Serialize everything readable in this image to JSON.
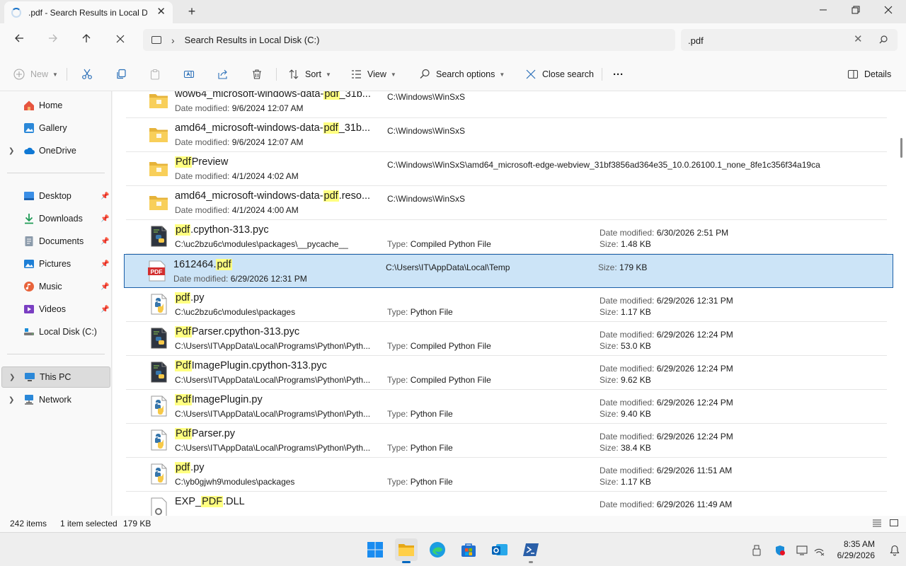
{
  "window": {
    "tab_title": ".pdf - Search Results in Local Disk (C:)",
    "new_tab": "+",
    "minimize": "—",
    "close": "✕"
  },
  "address": {
    "breadcrumb": "Search Results in Local Disk (C:)",
    "search_value": ".pdf",
    "search_placeholder": "Search"
  },
  "toolbar": {
    "new_label": "New",
    "sort_label": "Sort",
    "view_label": "View",
    "search_options_label": "Search options",
    "close_search_label": "Close search",
    "more_label": "···",
    "details_label": "Details"
  },
  "sidebar": {
    "items": [
      {
        "label": "Home"
      },
      {
        "label": "Gallery"
      },
      {
        "label": "OneDrive"
      },
      {
        "label": "Desktop"
      },
      {
        "label": "Downloads"
      },
      {
        "label": "Documents"
      },
      {
        "label": "Pictures"
      },
      {
        "label": "Music"
      },
      {
        "label": "Videos"
      },
      {
        "label": "Local Disk (C:)"
      },
      {
        "label": "This PC"
      },
      {
        "label": "Network"
      }
    ]
  },
  "results": {
    "date_key": "Date modified:",
    "type_key": "Type:",
    "size_key": "Size:",
    "rows": [
      {
        "pre": "wow64_microsoft-windows-data-",
        "hl": "pdf",
        "post": "_31b...",
        "sub": "9/6/2024 12:07 AM",
        "location": "C:\\Windows\\WinSxS",
        "icon": "folder-icon"
      },
      {
        "pre": "amd64_microsoft-windows-data-",
        "hl": "pdf",
        "post": "_31b...",
        "sub": "9/6/2024 12:07 AM",
        "location": "C:\\Windows\\WinSxS",
        "icon": "folder-icon"
      },
      {
        "pre": "",
        "hl": "Pdf",
        "post": "Preview",
        "sub": "4/1/2024 4:02 AM",
        "location": "C:\\Windows\\WinSxS\\amd64_microsoft-edge-webview_31bf3856ad364e35_10.0.26100.1_none_8fe1c356f34a19ca",
        "icon": "folder-icon"
      },
      {
        "pre": "amd64_microsoft-windows-data-",
        "hl": "pdf",
        "post": ".reso...",
        "sub": "4/1/2024 4:00 AM",
        "location": "C:\\Windows\\WinSxS",
        "icon": "folder-icon"
      },
      {
        "pre": "",
        "hl": "pdf",
        "post": ".cpython-313.pyc",
        "path": "C:\\uc2bzu6c\\modules\\packages\\__pycache__",
        "type": "Compiled Python File",
        "date": "6/30/2026 2:51 PM",
        "size": "1.48 KB",
        "icon": "compiled-python-file-icon"
      },
      {
        "pre": "1612464.",
        "hl": "pdf",
        "post": "",
        "sub": "6/29/2026 12:31 PM",
        "location": "C:\\Users\\IT\\AppData\\Local\\Temp",
        "size": "179 KB",
        "icon": "pdf-file-icon"
      },
      {
        "pre": "",
        "hl": "pdf",
        "post": ".py",
        "path": "C:\\uc2bzu6c\\modules\\packages",
        "type": "Python File",
        "date": "6/29/2026 12:31 PM",
        "size": "1.17 KB",
        "icon": "python-file-icon"
      },
      {
        "pre": "",
        "hl": "Pdf",
        "post": "Parser.cpython-313.pyc",
        "path": "C:\\Users\\IT\\AppData\\Local\\Programs\\Python\\Pyth...",
        "type": "Compiled Python File",
        "date": "6/29/2026 12:24 PM",
        "size": "53.0 KB",
        "icon": "compiled-python-file-icon"
      },
      {
        "pre": "",
        "hl": "Pdf",
        "post": "ImagePlugin.cpython-313.pyc",
        "path": "C:\\Users\\IT\\AppData\\Local\\Programs\\Python\\Pyth...",
        "type": "Compiled Python File",
        "date": "6/29/2026 12:24 PM",
        "size": "9.62 KB",
        "icon": "compiled-python-file-icon"
      },
      {
        "pre": "",
        "hl": "Pdf",
        "post": "ImagePlugin.py",
        "path": "C:\\Users\\IT\\AppData\\Local\\Programs\\Python\\Pyth...",
        "type": "Python File",
        "date": "6/29/2026 12:24 PM",
        "size": "9.40 KB",
        "icon": "python-file-icon"
      },
      {
        "pre": "",
        "hl": "Pdf",
        "post": "Parser.py",
        "path": "C:\\Users\\IT\\AppData\\Local\\Programs\\Python\\Pyth...",
        "type": "Python File",
        "date": "6/29/2026 12:24 PM",
        "size": "38.4 KB",
        "icon": "python-file-icon"
      },
      {
        "pre": "",
        "hl": "pdf",
        "post": ".py",
        "path": "C:\\yb0gjwh9\\modules\\packages",
        "type": "Python File",
        "date": "6/29/2026 11:51 AM",
        "size": "1.17 KB",
        "icon": "python-file-icon"
      },
      {
        "pre": "EXP_",
        "hl": "PDF",
        "post": ".DLL",
        "date": "6/29/2026 11:49 AM",
        "icon": "dll-file-icon"
      }
    ]
  },
  "status": {
    "item_count": "242 items",
    "selection": "1 item selected",
    "selection_size": "179 KB"
  },
  "taskbar": {
    "time": "8:35 AM",
    "date": "6/29/2026"
  },
  "colors": {
    "accent": "#0067c0",
    "selection_bg": "#cce4f7",
    "selection_border": "#1a5fa8",
    "highlight": "#ffff80",
    "folder": "#f8cf5a"
  }
}
